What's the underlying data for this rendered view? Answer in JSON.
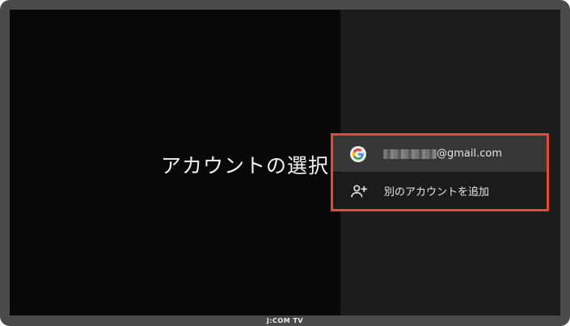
{
  "screen": {
    "title": "アカウントの選択"
  },
  "accounts": {
    "selected": {
      "icon": "google-g-icon",
      "email_suffix": "@gmail.com",
      "email_redacted": true
    },
    "add_account": {
      "icon": "person-add-icon",
      "label": "別のアカウントを追加"
    }
  },
  "highlight_color": "#e8482c",
  "device_label": "J:COM TV"
}
